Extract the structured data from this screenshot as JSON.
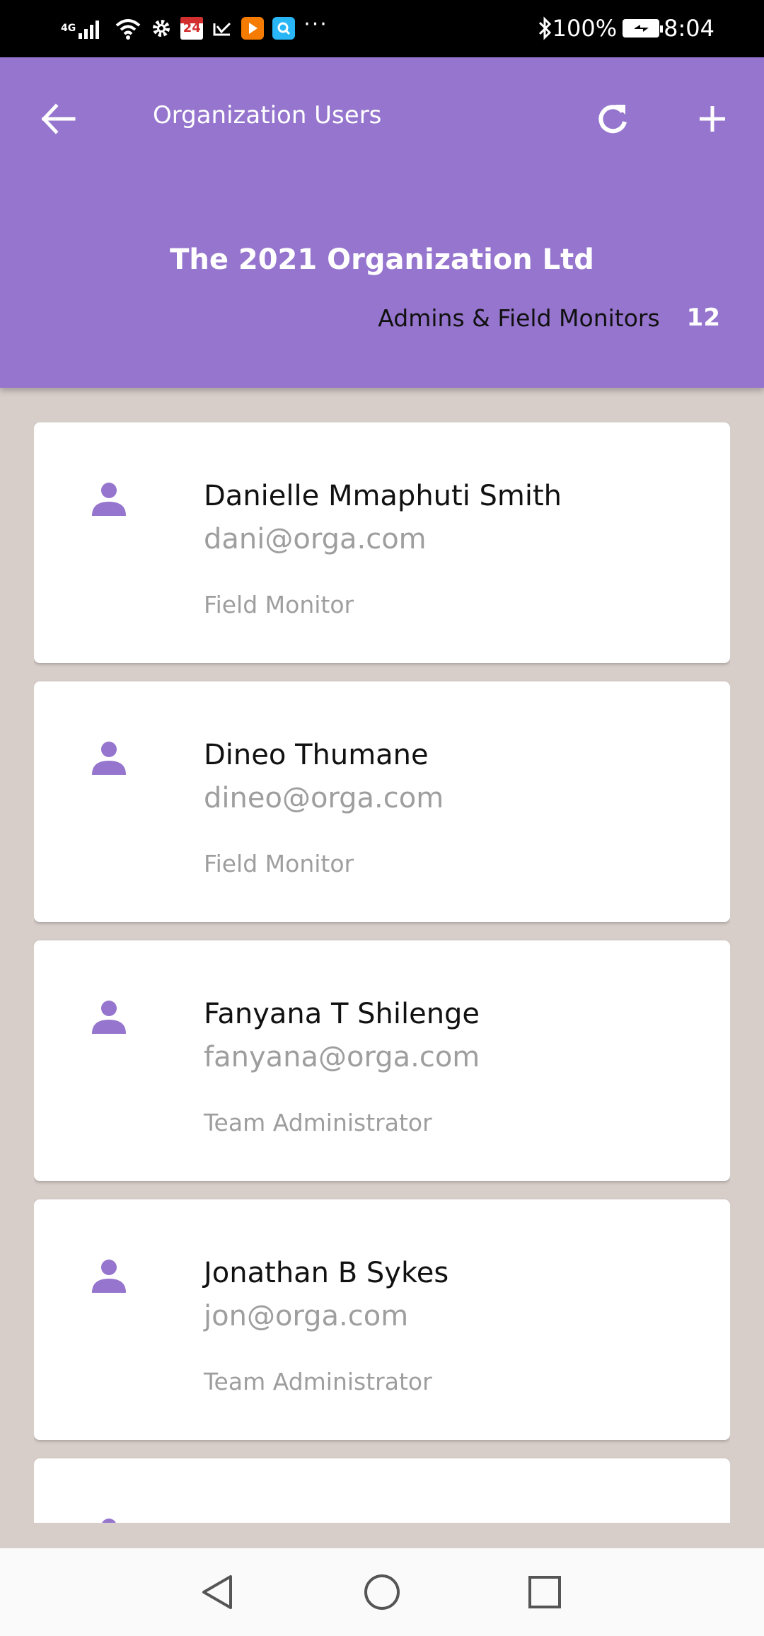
{
  "status_bar": {
    "network_label": "4G",
    "calendar_day": "24",
    "battery": "100%",
    "time": "8:04",
    "icons": [
      "signal-icon",
      "wifi-icon",
      "gear-icon",
      "calendar-icon",
      "check-icon",
      "play-icon",
      "search-app-icon",
      "more-dots-icon",
      "bluetooth-icon",
      "battery-icon"
    ]
  },
  "header": {
    "title": "Organization Users",
    "organization": "The 2021 Organization Ltd",
    "subtitle": "Admins & Field Monitors",
    "count": "12",
    "icons": {
      "back": "arrow-left-icon",
      "refresh": "refresh-icon",
      "add": "plus-icon"
    }
  },
  "users": [
    {
      "name": "Danielle Mmaphuti Smith",
      "email": "dani@orga.com",
      "role": "Field Monitor"
    },
    {
      "name": "Dineo Thumane",
      "email": "dineo@orga.com",
      "role": "Field Monitor"
    },
    {
      "name": "Fanyana T Shilenge",
      "email": "fanyana@orga.com",
      "role": "Team Administrator"
    },
    {
      "name": "Jonathan B Sykes",
      "email": "jon@orga.com",
      "role": "Team Administrator"
    }
  ],
  "colors": {
    "accent": "#9575cd",
    "background": "#d7cdc9",
    "secondary_text": "#9e9e9e"
  },
  "nav": {
    "icons": [
      "back-triangle-icon",
      "home-circle-icon",
      "recents-square-icon"
    ]
  }
}
